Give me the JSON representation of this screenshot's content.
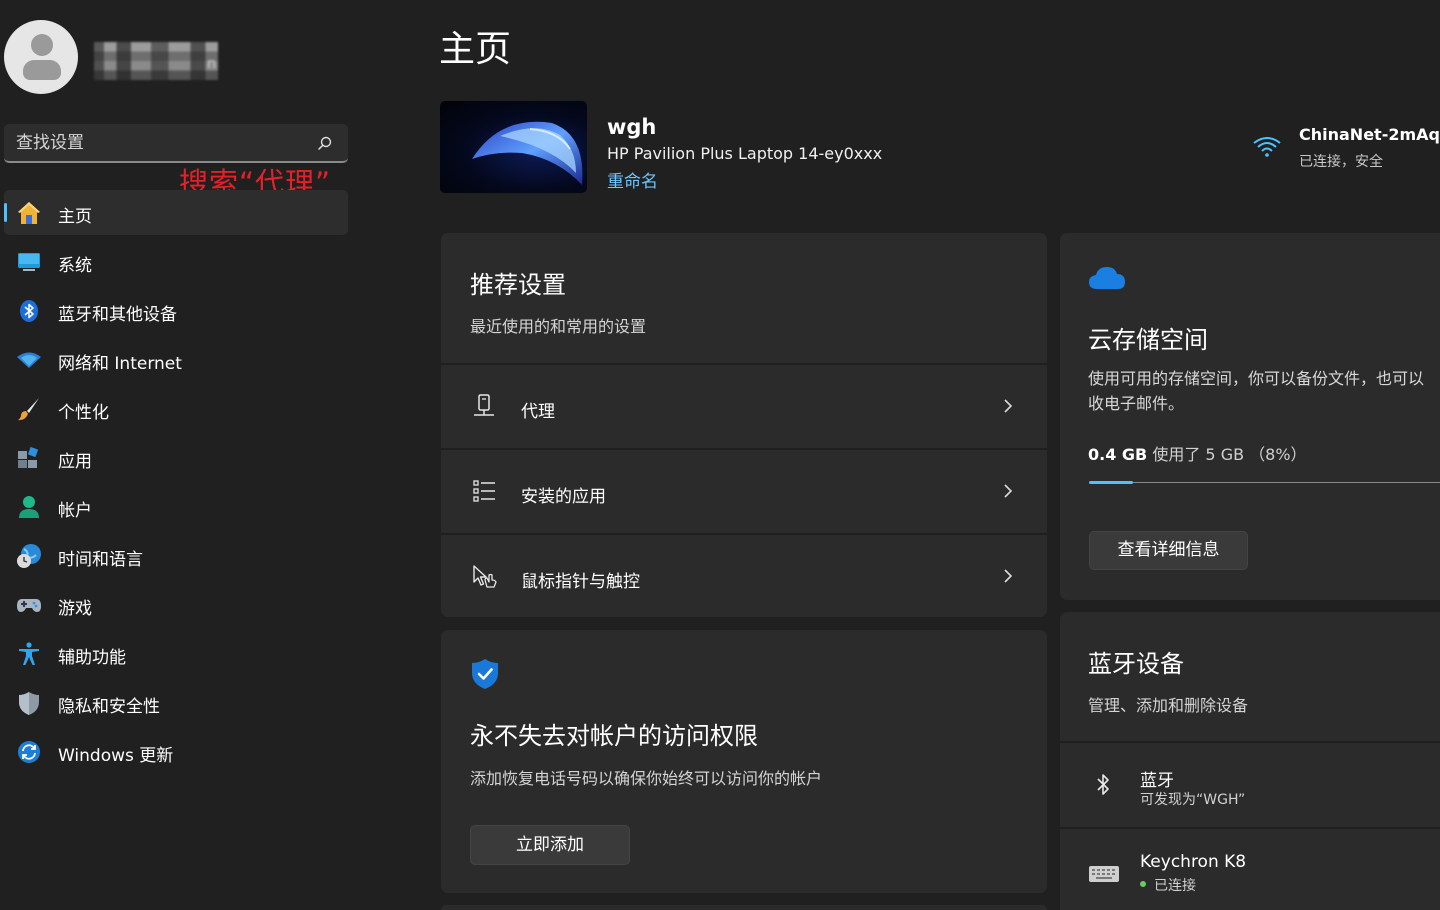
{
  "sidebar": {
    "username": "n",
    "search_placeholder": "查找设置",
    "annotation": "搜索“代理”",
    "items": [
      {
        "label": "主页"
      },
      {
        "label": "系统"
      },
      {
        "label": "蓝牙和其他设备"
      },
      {
        "label": "网络和 Internet"
      },
      {
        "label": "个性化"
      },
      {
        "label": "应用"
      },
      {
        "label": "帐户"
      },
      {
        "label": "时间和语言"
      },
      {
        "label": "游戏"
      },
      {
        "label": "辅助功能"
      },
      {
        "label": "隐私和安全性"
      },
      {
        "label": "Windows 更新"
      }
    ]
  },
  "main": {
    "title": "主页",
    "device": {
      "name": "wgh",
      "model": "HP Pavilion Plus Laptop 14-ey0xxx",
      "rename": "重命名"
    },
    "network": {
      "name": "ChinaNet-2mAq",
      "status": "已连接，安全"
    },
    "recommended": {
      "title": "推荐设置",
      "subtitle": "最近使用的和常用的设置",
      "rows": [
        {
          "label": "代理"
        },
        {
          "label": "安装的应用"
        },
        {
          "label": "鼠标指针与触控"
        }
      ]
    },
    "account": {
      "title": "永不失去对帐户的访问权限",
      "subtitle": "添加恢复电话号码以确保你始终可以访问你的帐户",
      "button": "立即添加"
    },
    "cloud": {
      "title": "云存储空间",
      "desc_line1": "使用可用的存储空间，你可以备份文件，也可以",
      "desc_line2": "收电子邮件。",
      "used": "0.4 GB",
      "used_text": "使用了 5 GB （8%）",
      "percent": 8,
      "button": "查看详细信息"
    },
    "bluetooth": {
      "title": "蓝牙设备",
      "subtitle": "管理、添加和删除设备",
      "devices": [
        {
          "name": "蓝牙",
          "status": "可发现为“WGH”"
        },
        {
          "name": "Keychron K8",
          "status": "已连接"
        }
      ]
    }
  },
  "colors": {
    "accent": "#4cc2ff",
    "annotation": "#e5202a",
    "connected": "#6ccb5f"
  }
}
